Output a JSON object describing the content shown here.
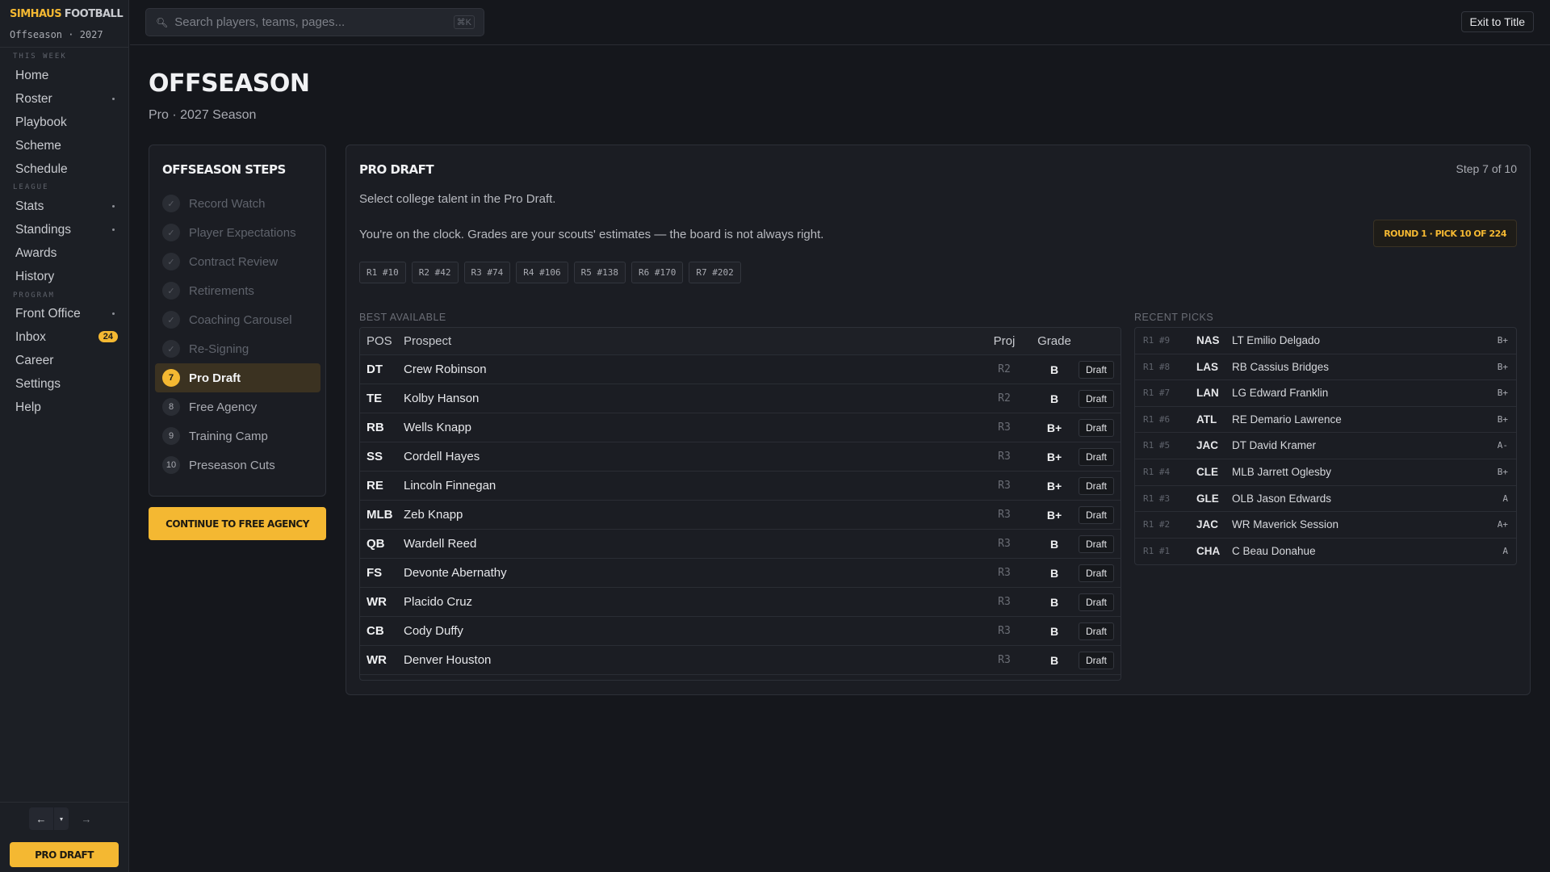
{
  "app": {
    "brand_primary": "SIMHAUS",
    "brand_secondary": "FOOTBALL",
    "subtitle": "Offseason · 2027",
    "accent_color": "#f4b832"
  },
  "sidebar": {
    "sections": [
      "THIS WEEK",
      "LEAGUE",
      "PROGRAM"
    ],
    "items": [
      {
        "label": "Home",
        "has_submenu": false
      },
      {
        "label": "Roster",
        "has_submenu": true
      },
      {
        "label": "Playbook",
        "has_submenu": false
      },
      {
        "label": "Scheme",
        "has_submenu": false
      },
      {
        "label": "Schedule",
        "has_submenu": false
      },
      {
        "label": "Stats",
        "has_submenu": true
      },
      {
        "label": "Standings",
        "has_submenu": true
      },
      {
        "label": "Awards",
        "has_submenu": false
      },
      {
        "label": "History",
        "has_submenu": false
      },
      {
        "label": "Front Office",
        "has_submenu": true
      },
      {
        "label": "Inbox",
        "badge": "24"
      },
      {
        "label": "Career",
        "has_submenu": false
      },
      {
        "label": "Settings",
        "has_submenu": false
      },
      {
        "label": "Help",
        "has_submenu": false
      }
    ],
    "history_back": "←",
    "history_dropdown": "▾",
    "history_forward": "→",
    "cta_label": "PRO DRAFT"
  },
  "topbar": {
    "search_placeholder": "Search players, teams, pages...",
    "search_shortcut": "⌘K",
    "exit_label": "Exit to Title"
  },
  "page": {
    "title": "OFFSEASON",
    "subtitle": "Pro · 2027 Season"
  },
  "steps": {
    "title": "OFFSEASON STEPS",
    "items": [
      {
        "num": "✓",
        "label": "Record Watch",
        "state": "done"
      },
      {
        "num": "✓",
        "label": "Player Expectations",
        "state": "done"
      },
      {
        "num": "✓",
        "label": "Contract Review",
        "state": "done"
      },
      {
        "num": "✓",
        "label": "Retirements",
        "state": "done"
      },
      {
        "num": "✓",
        "label": "Coaching Carousel",
        "state": "done"
      },
      {
        "num": "✓",
        "label": "Re-Signing",
        "state": "done"
      },
      {
        "num": "7",
        "label": "Pro Draft",
        "state": "active"
      },
      {
        "num": "8",
        "label": "Free Agency",
        "state": "todo"
      },
      {
        "num": "9",
        "label": "Training Camp",
        "state": "todo"
      },
      {
        "num": "10",
        "label": "Preseason Cuts",
        "state": "todo"
      }
    ],
    "continue_label": "CONTINUE TO FREE AGENCY"
  },
  "draft": {
    "title": "PRO DRAFT",
    "step_count": "Step 7 of 10",
    "description": "Select college talent in the Pro Draft.",
    "note": "You're on the clock. Grades are your scouts' estimates — the board is not always right.",
    "pick_status": "ROUND 1 · PICK 10 OF 224",
    "my_picks": [
      "R1 #10",
      "R2 #42",
      "R3 #74",
      "R4 #106",
      "R5 #138",
      "R6 #170",
      "R7 #202"
    ],
    "best_available_label": "BEST AVAILABLE",
    "recent_picks_label": "RECENT PICKS",
    "columns": {
      "pos": "POS",
      "prospect": "Prospect",
      "proj": "Proj",
      "grade": "Grade"
    },
    "draft_button_label": "Draft",
    "prospects": [
      {
        "pos": "DT",
        "name": "Crew Robinson",
        "proj": "R2",
        "grade": "B"
      },
      {
        "pos": "TE",
        "name": "Kolby Hanson",
        "proj": "R2",
        "grade": "B"
      },
      {
        "pos": "RB",
        "name": "Wells Knapp",
        "proj": "R3",
        "grade": "B+"
      },
      {
        "pos": "SS",
        "name": "Cordell Hayes",
        "proj": "R3",
        "grade": "B+"
      },
      {
        "pos": "RE",
        "name": "Lincoln Finnegan",
        "proj": "R3",
        "grade": "B+"
      },
      {
        "pos": "MLB",
        "name": "Zeb Knapp",
        "proj": "R3",
        "grade": "B+"
      },
      {
        "pos": "QB",
        "name": "Wardell Reed",
        "proj": "R3",
        "grade": "B"
      },
      {
        "pos": "FS",
        "name": "Devonte Abernathy",
        "proj": "R3",
        "grade": "B"
      },
      {
        "pos": "WR",
        "name": "Placido Cruz",
        "proj": "R3",
        "grade": "B"
      },
      {
        "pos": "CB",
        "name": "Cody Duffy",
        "proj": "R3",
        "grade": "B"
      },
      {
        "pos": "WR",
        "name": "Denver Houston",
        "proj": "R3",
        "grade": "B"
      }
    ],
    "recent_picks": [
      {
        "pick": "R1 #9",
        "team": "NAS",
        "player": "LT Emilio Delgado",
        "grade": "B+"
      },
      {
        "pick": "R1 #8",
        "team": "LAS",
        "player": "RB Cassius Bridges",
        "grade": "B+"
      },
      {
        "pick": "R1 #7",
        "team": "LAN",
        "player": "LG Edward Franklin",
        "grade": "B+"
      },
      {
        "pick": "R1 #6",
        "team": "ATL",
        "player": "RE Demario Lawrence",
        "grade": "B+"
      },
      {
        "pick": "R1 #5",
        "team": "JAC",
        "player": "DT David Kramer",
        "grade": "A-"
      },
      {
        "pick": "R1 #4",
        "team": "CLE",
        "player": "MLB Jarrett Oglesby",
        "grade": "B+"
      },
      {
        "pick": "R1 #3",
        "team": "GLE",
        "player": "OLB Jason Edwards",
        "grade": "A"
      },
      {
        "pick": "R1 #2",
        "team": "JAC",
        "player": "WR Maverick Session",
        "grade": "A+"
      },
      {
        "pick": "R1 #1",
        "team": "CHA",
        "player": "C Beau Donahue",
        "grade": "A"
      }
    ]
  }
}
